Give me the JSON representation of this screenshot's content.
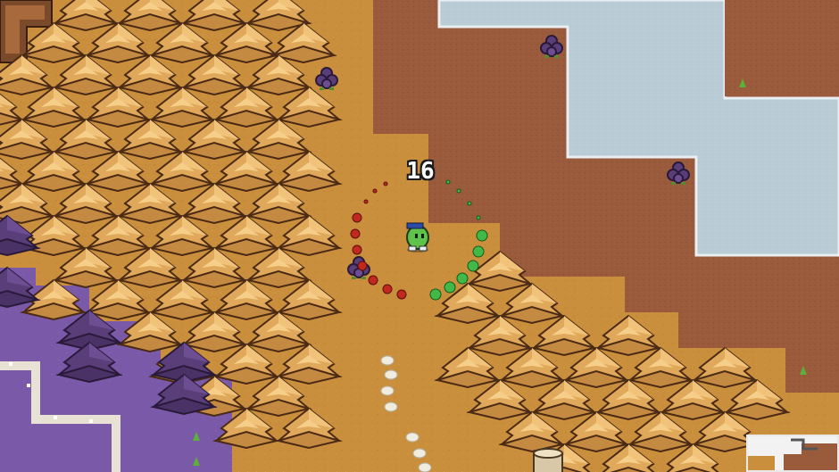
{
  "hud": {
    "damage_number": "16"
  },
  "scene": {
    "description_free": true,
    "palette": {
      "grass": "#c98f3d",
      "dirt": "#9a5a3c",
      "ice": "#b9ccd6",
      "poison_ground": "#7a5aa8",
      "tree_autumn": "#e0a85a",
      "tree_dark": "#5a3e7a",
      "slime_player": "#5fc24a",
      "enemy_grape": "#5a3e7a"
    }
  },
  "icons": [
    "player-slime-icon",
    "grape-enemy-icon",
    "tree-stump-icon",
    "minimap-icon"
  ]
}
